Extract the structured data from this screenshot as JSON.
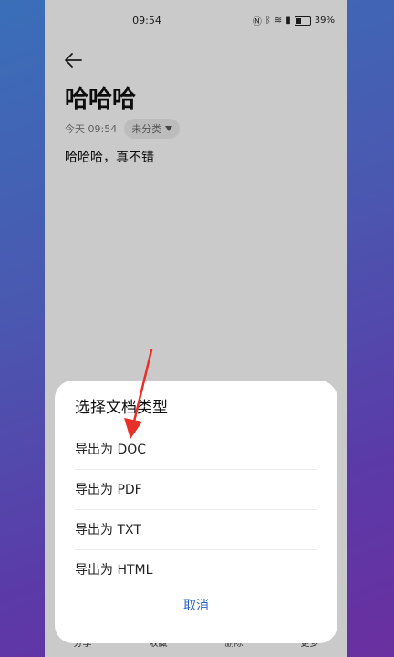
{
  "status_bar": {
    "time": "09:54",
    "battery": "39%"
  },
  "note": {
    "title": "哈哈哈",
    "date": "今天 09:54",
    "category": "未分类",
    "body": "哈哈哈，真不错"
  },
  "bottom_bar": {
    "items": [
      "分享",
      "收藏",
      "删除",
      "更多"
    ]
  },
  "sheet": {
    "title": "选择文档类型",
    "options": [
      "导出为 DOC",
      "导出为 PDF",
      "导出为 TXT",
      "导出为 HTML"
    ],
    "cancel": "取消"
  },
  "colors": {
    "accent": "#2a63c8",
    "annotation": "#e8302a"
  }
}
